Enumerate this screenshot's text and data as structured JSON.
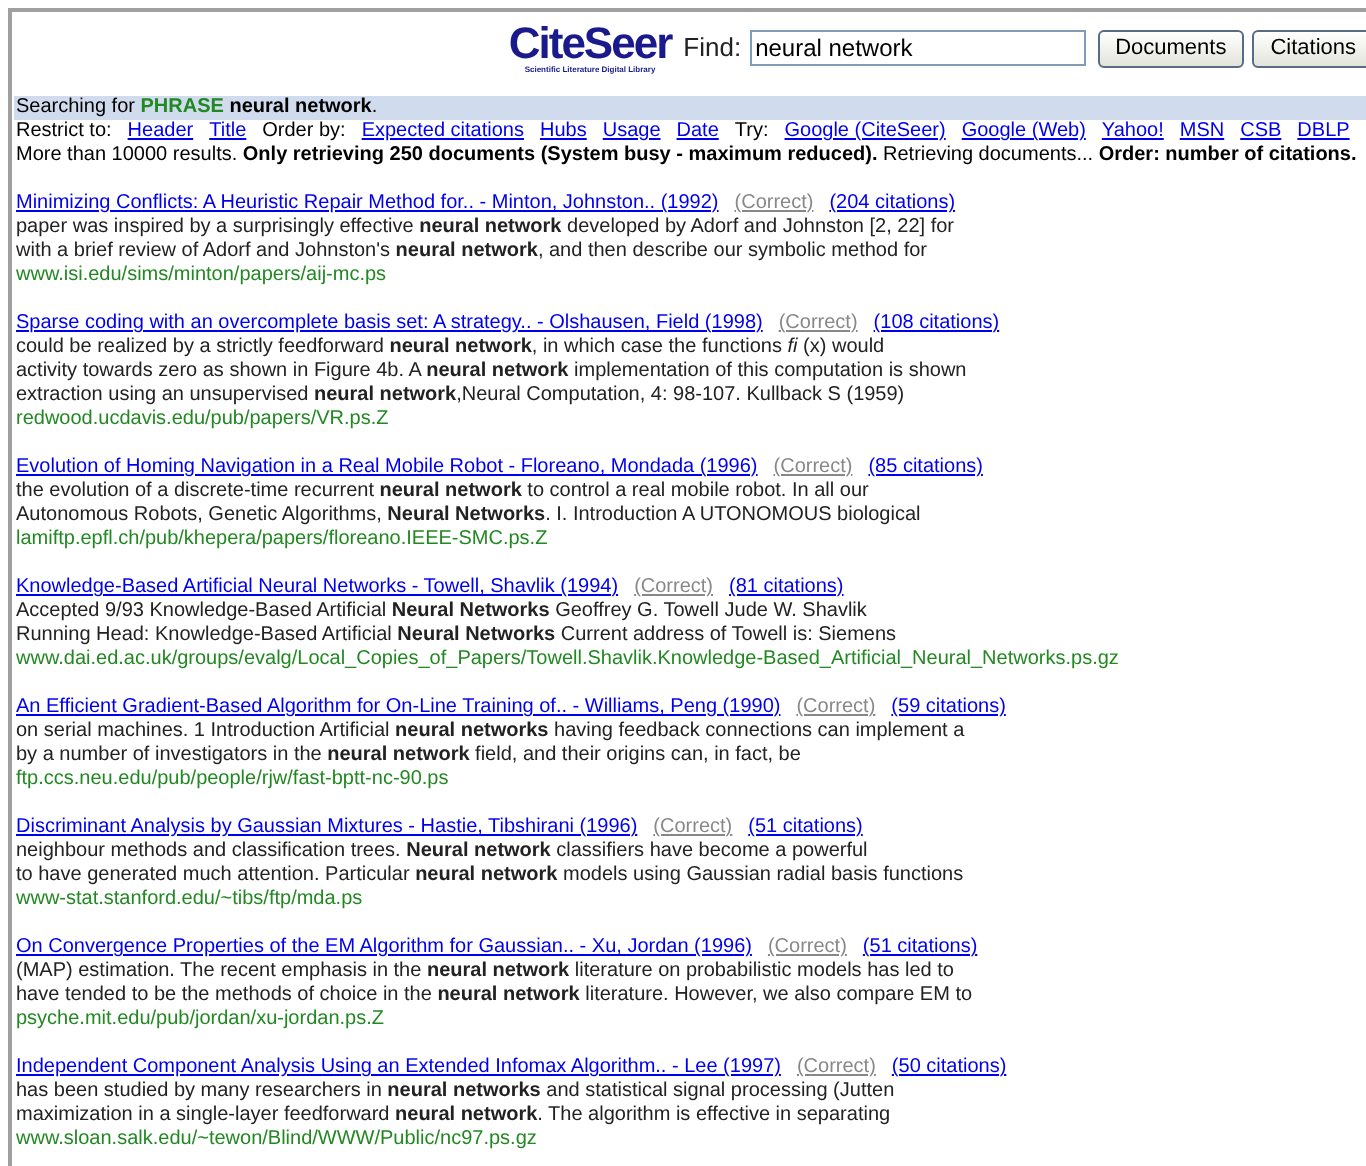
{
  "header": {
    "logo": "CiteSeer",
    "logo_tagline": "Scientific Literature Digital Library",
    "find_label": "Find:",
    "search": {
      "value": "neural network"
    },
    "buttons": [
      "Documents",
      "Citations"
    ]
  },
  "status": {
    "prefix": "Searching for",
    "mode": "PHRASE",
    "query": "neural network",
    "suffix": "."
  },
  "options": [
    {
      "kind": "label",
      "text": "Restrict to:"
    },
    {
      "kind": "link",
      "text": "Header"
    },
    {
      "kind": "link",
      "text": "Title"
    },
    {
      "kind": "label",
      "text": "Order by:"
    },
    {
      "kind": "link",
      "text": "Expected citations"
    },
    {
      "kind": "link",
      "text": "Hubs"
    },
    {
      "kind": "link",
      "text": "Usage"
    },
    {
      "kind": "link",
      "text": "Date"
    },
    {
      "kind": "label",
      "text": "Try:"
    },
    {
      "kind": "link",
      "text": "Google (CiteSeer)"
    },
    {
      "kind": "link",
      "text": "Google (Web)"
    },
    {
      "kind": "link",
      "text": "Yahoo!"
    },
    {
      "kind": "link",
      "text": "MSN"
    },
    {
      "kind": "link",
      "text": "CSB"
    },
    {
      "kind": "link",
      "text": "DBLP"
    }
  ],
  "summary": "More than 10000 results. **Only retrieving 250 documents (System busy - maximum reduced).** Retrieving documents... **Order: number of citations.**",
  "results": [
    {
      "title": "Minimizing Conflicts: A Heuristic Repair Method for.. - Minton, Johnston.. (1992)",
      "correct": "(Correct)",
      "citations": "(204 citations)",
      "snippet": [
        "paper was inspired by a surprisingly effective **neural network** developed by Adorf and Johnston [2, 22] for",
        "with a brief review of Adorf and Johnston's **neural network**, and then describe our symbolic method for"
      ],
      "url": "www.isi.edu/sims/minton/papers/aij-mc.ps"
    },
    {
      "title": "Sparse coding with an overcomplete basis set: A strategy.. - Olshausen, Field (1998)",
      "correct": "(Correct)",
      "citations": "(108 citations)",
      "snippet": [
        "could be realized by a strictly feedforward **neural network**, in which case the functions *fi* (x) would",
        "activity towards zero as shown in Figure 4b. A **neural network** implementation of this computation is shown",
        "extraction using an unsupervised **neural network**,Neural Computation, 4: 98-107. Kullback S (1959)"
      ],
      "url": "redwood.ucdavis.edu/pub/papers/VR.ps.Z"
    },
    {
      "title": "Evolution of Homing Navigation in a Real Mobile Robot - Floreano, Mondada (1996)",
      "correct": "(Correct)",
      "citations": "(85 citations)",
      "snippet": [
        "the evolution of a discrete-time recurrent **neural network** to control a real mobile robot. In all our",
        "Autonomous Robots, Genetic Algorithms, **Neural Networks**. I. Introduction A UTONOMOUS biological"
      ],
      "url": "lamiftp.epfl.ch/pub/khepera/papers/floreano.IEEE-SMC.ps.Z"
    },
    {
      "title": "Knowledge-Based Artificial Neural Networks - Towell, Shavlik (1994)",
      "correct": "(Correct)",
      "citations": "(81 citations)",
      "snippet": [
        "Accepted 9/93 Knowledge-Based Artificial **Neural Networks** Geoffrey G. Towell Jude W. Shavlik",
        "Running Head: Knowledge-Based Artificial **Neural Networks** Current address of Towell is: Siemens"
      ],
      "url": "www.dai.ed.ac.uk/groups/evalg/Local_Copies_of_Papers/Towell.Shavlik.Knowledge-Based_Artificial_Neural_Networks.ps.gz"
    },
    {
      "title": "An Efficient Gradient-Based Algorithm for On-Line Training of.. - Williams, Peng (1990)",
      "correct": "(Correct)",
      "citations": "(59 citations)",
      "snippet": [
        "on serial machines. 1 Introduction Artificial **neural networks** having feedback connections can implement a",
        "by a number of investigators in the **neural network** field, and their origins can, in fact, be"
      ],
      "url": "ftp.ccs.neu.edu/pub/people/rjw/fast-bptt-nc-90.ps"
    },
    {
      "title": "Discriminant Analysis by Gaussian Mixtures - Hastie, Tibshirani (1996)",
      "correct": "(Correct)",
      "citations": "(51 citations)",
      "snippet": [
        "neighbour methods and classification trees. **Neural network** classifiers have become a powerful",
        "to have generated much attention. Particular **neural network** models using Gaussian radial basis functions"
      ],
      "url": "www-stat.stanford.edu/~tibs/ftp/mda.ps"
    },
    {
      "title": "On Convergence Properties of the EM Algorithm for Gaussian.. - Xu, Jordan (1996)",
      "correct": "(Correct)",
      "citations": "(51 citations)",
      "snippet": [
        "(MAP) estimation. The recent emphasis in the **neural network** literature on probabilistic models has led to",
        "have tended to be the methods of choice in the **neural network** literature. However, we also compare EM to"
      ],
      "url": "psyche.mit.edu/pub/jordan/xu-jordan.ps.Z"
    },
    {
      "title": "Independent Component Analysis Using an Extended Infomax Algorithm.. - Lee (1997)",
      "correct": "(Correct)",
      "citations": "(50 citations)",
      "snippet": [
        "has been studied by many researchers in **neural networks** and statistical signal processing (Jutten",
        "maximization in a single-layer feedforward **neural network**. The algorithm is effective in separating"
      ],
      "url": "www.sloan.salk.edu/~tewon/Blind/WWW/Public/nc97.ps.gz"
    }
  ]
}
